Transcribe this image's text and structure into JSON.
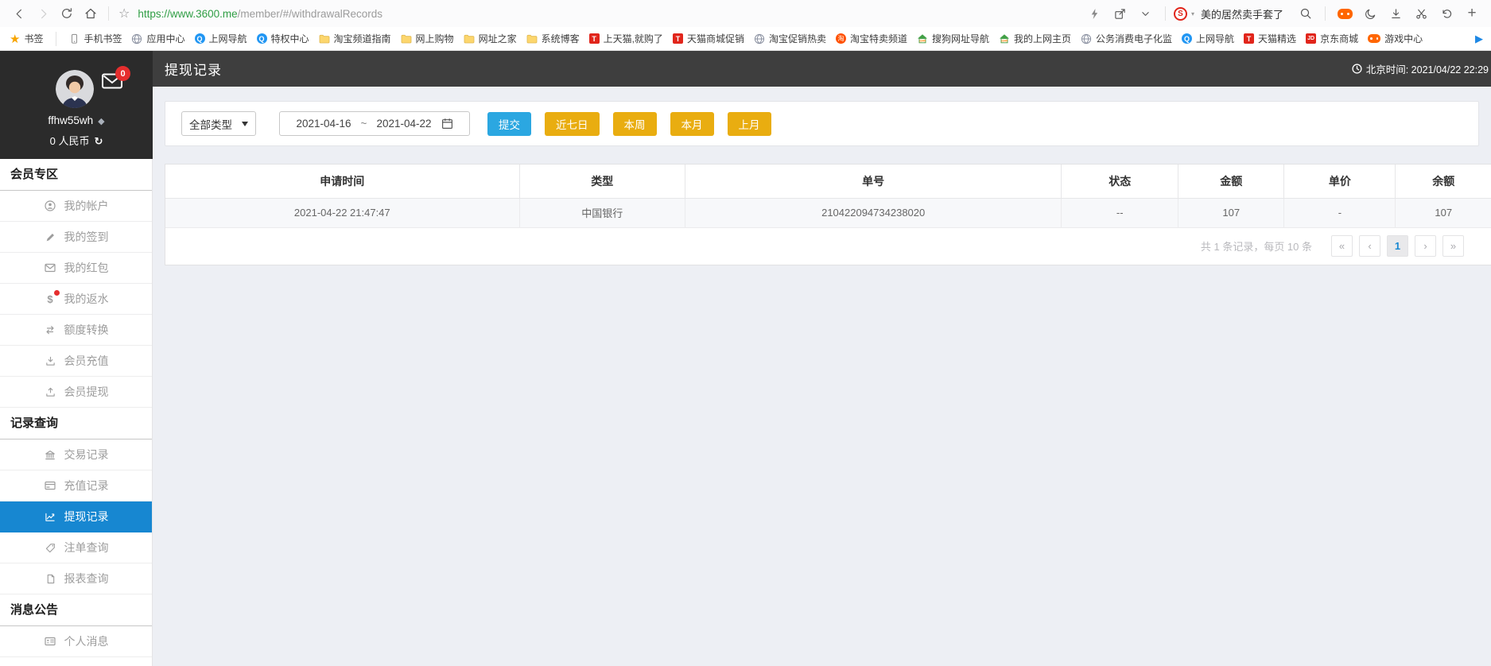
{
  "browser": {
    "url": {
      "host": "https://www.3600.me",
      "path": "/member/#/withdrawalRecords"
    },
    "hotword": "美的居然卖手套了"
  },
  "bookmarks": {
    "root_label": "书签",
    "items": [
      {
        "icon": "phone-icon",
        "label": "手机书签"
      },
      {
        "icon": "globe-icon",
        "label": "应用中心"
      },
      {
        "icon": "q-icon",
        "label": "上网导航"
      },
      {
        "icon": "q-icon",
        "label": "特权中心"
      },
      {
        "icon": "folder-icon",
        "label": "淘宝频道指南"
      },
      {
        "icon": "folder-icon",
        "label": "网上购物"
      },
      {
        "icon": "folder-icon",
        "label": "网址之家"
      },
      {
        "icon": "folder-icon",
        "label": "系统博客"
      },
      {
        "icon": "tmall-icon",
        "label": "上天猫,就购了"
      },
      {
        "icon": "tmall-icon",
        "label": "天猫商城促销"
      },
      {
        "icon": "globe-icon",
        "label": "淘宝促销热卖"
      },
      {
        "icon": "taobao-icon",
        "label": "淘宝特卖频道"
      },
      {
        "icon": "house-icon",
        "label": "搜狗网址导航"
      },
      {
        "icon": "house-icon",
        "label": "我的上网主页"
      },
      {
        "icon": "globe-icon",
        "label": "公务消费电子化监"
      },
      {
        "icon": "q-icon",
        "label": "上网导航"
      },
      {
        "icon": "tmall-icon",
        "label": "天猫精选"
      },
      {
        "icon": "jd-icon",
        "label": "京东商城"
      },
      {
        "icon": "gamepad-icon",
        "label": "游戏中心"
      }
    ],
    "tmall_glyph": "T",
    "jd_glyph": "JD",
    "taobao_glyph": "淘",
    "q_glyph": "Q",
    "s_glyph": "S"
  },
  "header": {
    "title": "提现记录",
    "time": "北京时间: 2021/04/22 22:29"
  },
  "profile": {
    "username": "ffhw55wh",
    "balance": "0 人民币",
    "unread": "0",
    "refresh_glyph": "↻",
    "diamond_glyph": "◆"
  },
  "sidebar": {
    "sections": [
      {
        "title": "会员专区",
        "items": [
          {
            "label": "我的帐户"
          },
          {
            "label": "我的签到"
          },
          {
            "label": "我的红包"
          },
          {
            "label": "我的返水"
          },
          {
            "label": "额度转换"
          },
          {
            "label": "会员充值"
          },
          {
            "label": "会员提现"
          }
        ]
      },
      {
        "title": "记录查询",
        "items": [
          {
            "label": "交易记录"
          },
          {
            "label": "充值记录"
          },
          {
            "label": "提现记录"
          },
          {
            "label": "注单查询"
          },
          {
            "label": "报表查询"
          }
        ]
      },
      {
        "title": "消息公告",
        "items": [
          {
            "label": "个人消息"
          }
        ]
      }
    ],
    "dollar_glyph": "$"
  },
  "filters": {
    "type_select": "全部类型",
    "date_from": "2021-04-16",
    "range_sep": "~",
    "date_to": "2021-04-22",
    "submit": "提交",
    "quick": [
      "近七日",
      "本周",
      "本月",
      "上月"
    ]
  },
  "table": {
    "columns": [
      "申请时间",
      "类型",
      "单号",
      "状态",
      "金额",
      "单价",
      "余额"
    ],
    "rows": [
      [
        "2021-04-22 21:47:47",
        "中国银行",
        "210422094734238020",
        "--",
        "107",
        "-",
        "107"
      ]
    ]
  },
  "pagination": {
    "summary": "共 1 条记录，每页 10 条",
    "first": "«",
    "prev": "‹",
    "page": "1",
    "next": "›",
    "last": "»"
  },
  "colors": {
    "accent_blue": "#1787d1",
    "submit_blue": "#2ba7e1",
    "gold": "#e9ad10",
    "danger_red": "#e62e2e"
  }
}
